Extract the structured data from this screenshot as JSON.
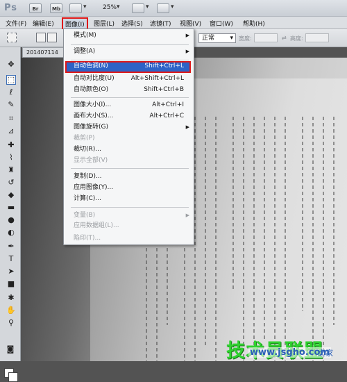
{
  "app": {
    "logo": "Ps",
    "br_button": "Br",
    "mb_button": "Mb",
    "zoom": "25%"
  },
  "menubar": [
    {
      "label": "文件(F)"
    },
    {
      "label": "编辑(E)"
    },
    {
      "label": "图像(I)"
    },
    {
      "label": "图层(L)"
    },
    {
      "label": "选择(S)"
    },
    {
      "label": "滤镜(T)"
    },
    {
      "label": "视图(V)"
    },
    {
      "label": "窗口(W)"
    },
    {
      "label": "帮助(H)"
    }
  ],
  "options": {
    "mode_value": "正常",
    "width_label": "宽度:",
    "height_label": "高度:"
  },
  "document": {
    "tab_title": "201407114"
  },
  "image_menu": {
    "items": [
      {
        "label": "模式(M)",
        "shortcut": "",
        "submenu": true,
        "disabled": false
      },
      {
        "label": "调整(A)",
        "shortcut": "",
        "submenu": true,
        "disabled": false
      },
      {
        "label": "自动色调(N)",
        "shortcut": "Shift+Ctrl+L",
        "submenu": false,
        "disabled": false
      },
      {
        "label": "自动对比度(U)",
        "shortcut": "Alt+Shift+Ctrl+L",
        "submenu": false,
        "disabled": false
      },
      {
        "label": "自动颜色(O)",
        "shortcut": "Shift+Ctrl+B",
        "submenu": false,
        "disabled": false
      },
      {
        "label": "图像大小(I)...",
        "shortcut": "Alt+Ctrl+I",
        "submenu": false,
        "disabled": false
      },
      {
        "label": "画布大小(S)...",
        "shortcut": "Alt+Ctrl+C",
        "submenu": false,
        "disabled": false
      },
      {
        "label": "图像旋转(G)",
        "shortcut": "",
        "submenu": true,
        "disabled": false
      },
      {
        "label": "裁剪(P)",
        "shortcut": "",
        "submenu": false,
        "disabled": true
      },
      {
        "label": "裁切(R)...",
        "shortcut": "",
        "submenu": false,
        "disabled": false
      },
      {
        "label": "显示全部(V)",
        "shortcut": "",
        "submenu": false,
        "disabled": true
      },
      {
        "label": "复制(D)...",
        "shortcut": "",
        "submenu": false,
        "disabled": false
      },
      {
        "label": "应用图像(Y)...",
        "shortcut": "",
        "submenu": false,
        "disabled": false
      },
      {
        "label": "计算(C)...",
        "shortcut": "",
        "submenu": false,
        "disabled": false
      },
      {
        "label": "变量(B)",
        "shortcut": "",
        "submenu": true,
        "disabled": true
      },
      {
        "label": "应用数据组(L)...",
        "shortcut": "",
        "submenu": false,
        "disabled": true
      },
      {
        "label": "陷印(T)...",
        "shortcut": "",
        "submenu": false,
        "disabled": true
      }
    ]
  },
  "watermark": {
    "brand": "技术员联盟",
    "url": "www.jsgho.com",
    "suffix": "之家"
  },
  "colors": {
    "highlight": "#2d63c7",
    "callout_red": "#e01818"
  }
}
